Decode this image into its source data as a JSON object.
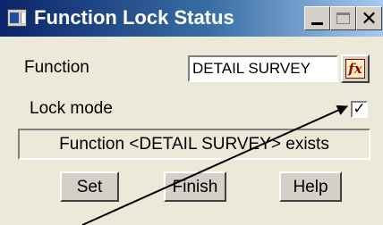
{
  "window": {
    "title": "Function Lock Status",
    "controls": {
      "close_glyph": "✕"
    }
  },
  "form": {
    "function_label": "Function",
    "function_value": "DETAIL SURVEY",
    "function_picker_icon": "fx-icon",
    "function_picker_glyph": "fx",
    "lock_mode_label": "Lock mode",
    "lock_mode_checked": true,
    "check_glyph": "✓",
    "status_message": "Function <DETAIL SURVEY> exists"
  },
  "buttons": {
    "set_label": "Set",
    "finish_label": "Finish",
    "help_label": "Help"
  },
  "colors": {
    "titlebar_start": "#0a246a",
    "titlebar_end": "#a6caf0",
    "dialog_face": "#ece9d8",
    "fx_icon": "#a00000"
  }
}
